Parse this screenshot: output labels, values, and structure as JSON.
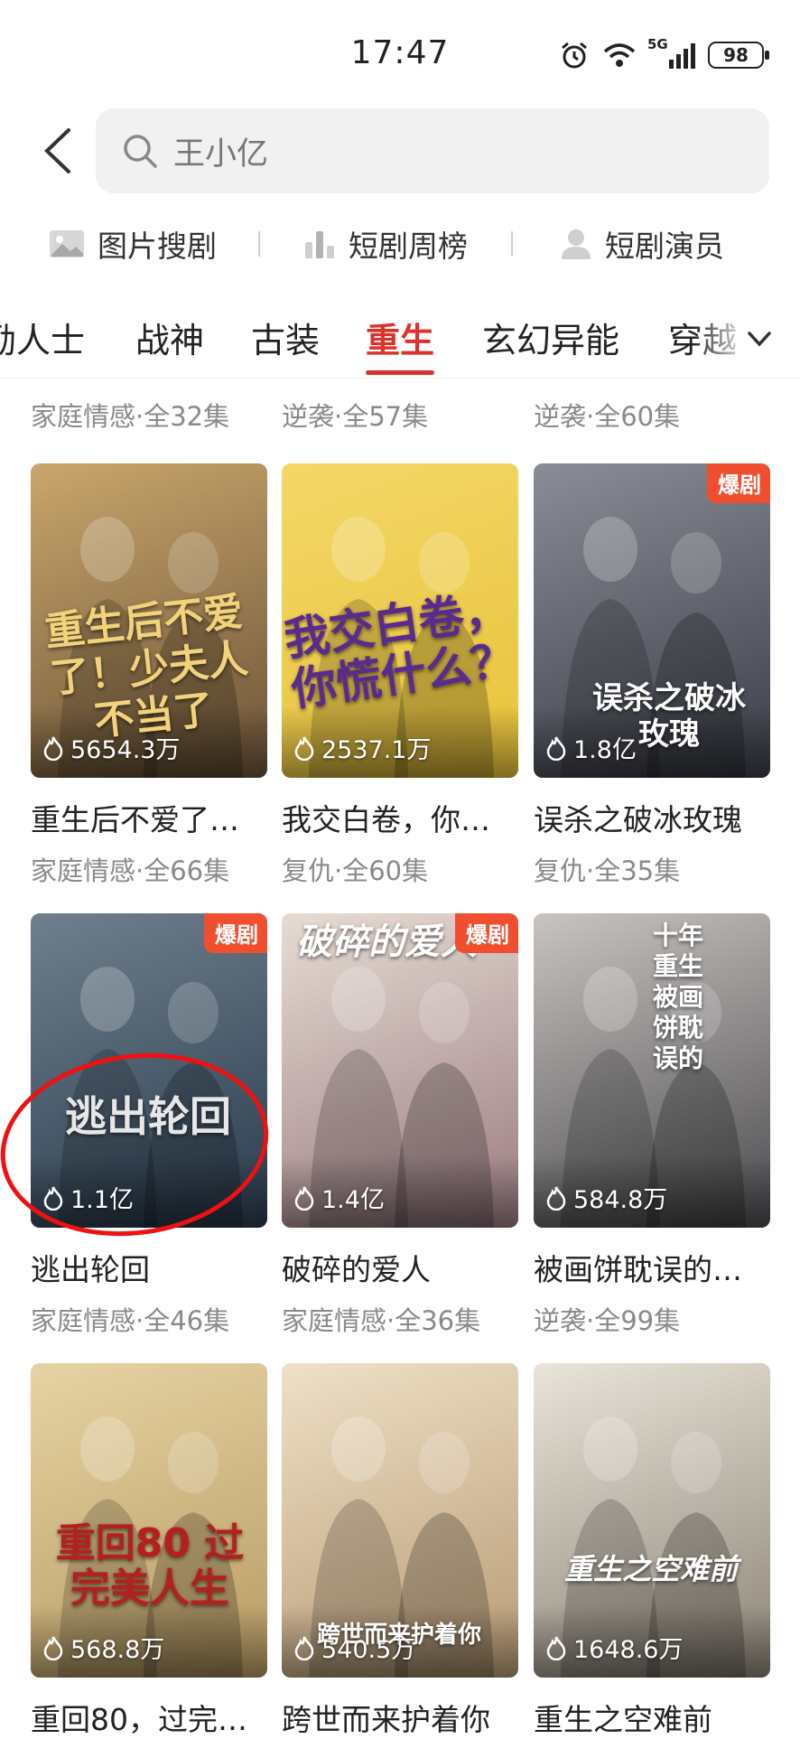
{
  "status_bar": {
    "time": "17:47",
    "network": "5G",
    "battery": "98"
  },
  "search": {
    "placeholder": "王小亿"
  },
  "shortcuts": [
    {
      "label": "图片搜剧",
      "icon": "image-icon"
    },
    {
      "label": "短剧周榜",
      "icon": "chart-icon"
    },
    {
      "label": "短剧演员",
      "icon": "person-icon"
    }
  ],
  "tabs": [
    {
      "label": "励人士",
      "active": false
    },
    {
      "label": "战神",
      "active": false
    },
    {
      "label": "古装",
      "active": false
    },
    {
      "label": "重生",
      "active": true
    },
    {
      "label": "玄幻异能",
      "active": false
    },
    {
      "label": "穿越",
      "active": false
    }
  ],
  "previous_row_meta": [
    "家庭情感·全32集",
    "逆袭·全57集",
    "逆袭·全60集"
  ],
  "dramas": [
    {
      "title": "重生后不爱了…",
      "meta": "家庭情感·全66集",
      "plays": "5654.3万",
      "badge": "",
      "poster_text": "重生后不爱了！少夫人不当了",
      "colors": [
        "#6b5338",
        "#c9a66b"
      ],
      "text_color": "#f2d27a"
    },
    {
      "title": "我交白卷，你…",
      "meta": "复仇·全60集",
      "plays": "2537.1万",
      "badge": "",
      "poster_text": "我交白卷，你慌什么？",
      "colors": [
        "#e8c23a",
        "#f3d767"
      ],
      "text_color": "#5b2a8e"
    },
    {
      "title": "误杀之破冰玫瑰",
      "meta": "复仇·全35集",
      "plays": "1.8亿",
      "badge": "爆剧",
      "poster_text": "误杀之破冰玫瑰",
      "colors": [
        "#3a3d47",
        "#8a8d96"
      ],
      "text_color": "#ffffff"
    },
    {
      "title": "逃出轮回",
      "meta": "家庭情感·全46集",
      "plays": "1.1亿",
      "badge": "爆剧",
      "poster_text": "逃出轮回",
      "colors": [
        "#2a3c4e",
        "#6f7f8d"
      ],
      "text_color": "#e7e7e7"
    },
    {
      "title": "破碎的爱人",
      "meta": "家庭情感·全36集",
      "plays": "1.4亿",
      "badge": "爆剧",
      "poster_text": "破碎的爱人",
      "colors": [
        "#9a7b80",
        "#e6dcd3"
      ],
      "text_color": "#ffffff"
    },
    {
      "title": "被画饼耽误的…",
      "meta": "逆袭·全99集",
      "plays": "584.8万",
      "badge": "",
      "poster_text": "十年重生 被画饼耽误的",
      "colors": [
        "#4b4a4e",
        "#c8c4c0"
      ],
      "text_color": "#ffffff"
    },
    {
      "title": "重回80，过完…",
      "meta": "",
      "plays": "568.8万",
      "badge": "",
      "poster_text": "重回80 过完美人生",
      "colors": [
        "#b89b63",
        "#e6d3a3"
      ],
      "text_color": "#b5201e"
    },
    {
      "title": "跨世而来护着你",
      "meta": "",
      "plays": "540.5万",
      "badge": "",
      "poster_text": "跨世而来护着你",
      "colors": [
        "#b79a74",
        "#efe0c6"
      ],
      "text_color": "#ffffff"
    },
    {
      "title": "重生之空难前",
      "meta": "",
      "plays": "1648.6万",
      "badge": "",
      "poster_text": "重生之空难前",
      "colors": [
        "#8c8376",
        "#e9e4d9"
      ],
      "text_color": "#ffffff"
    }
  ],
  "annotation": {
    "type": "red-circle",
    "target": "逃出轮回"
  },
  "colors": {
    "accent": "#d9342b",
    "badge": "#ef4f2f"
  }
}
